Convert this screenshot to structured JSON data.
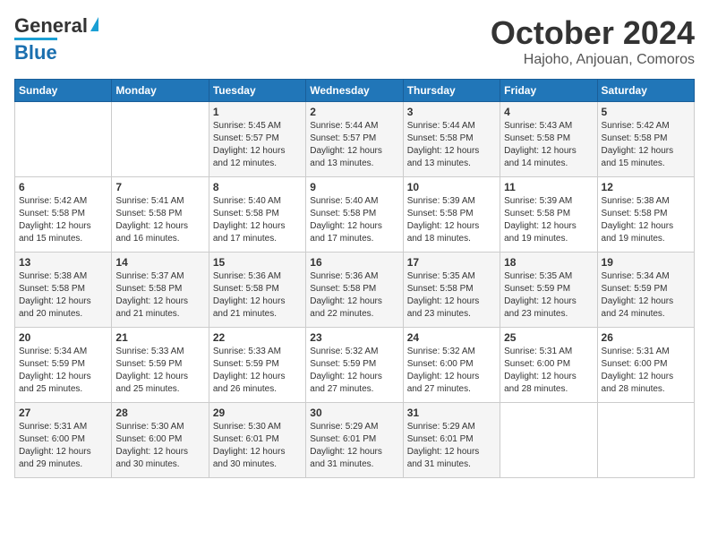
{
  "header": {
    "logo_line1": "General",
    "logo_line2": "Blue",
    "month": "October 2024",
    "location": "Hajoho, Anjouan, Comoros"
  },
  "days_of_week": [
    "Sunday",
    "Monday",
    "Tuesday",
    "Wednesday",
    "Thursday",
    "Friday",
    "Saturday"
  ],
  "weeks": [
    [
      {
        "day": "",
        "details": ""
      },
      {
        "day": "",
        "details": ""
      },
      {
        "day": "1",
        "details": "Sunrise: 5:45 AM\nSunset: 5:57 PM\nDaylight: 12 hours\nand 12 minutes."
      },
      {
        "day": "2",
        "details": "Sunrise: 5:44 AM\nSunset: 5:57 PM\nDaylight: 12 hours\nand 13 minutes."
      },
      {
        "day": "3",
        "details": "Sunrise: 5:44 AM\nSunset: 5:58 PM\nDaylight: 12 hours\nand 13 minutes."
      },
      {
        "day": "4",
        "details": "Sunrise: 5:43 AM\nSunset: 5:58 PM\nDaylight: 12 hours\nand 14 minutes."
      },
      {
        "day": "5",
        "details": "Sunrise: 5:42 AM\nSunset: 5:58 PM\nDaylight: 12 hours\nand 15 minutes."
      }
    ],
    [
      {
        "day": "6",
        "details": "Sunrise: 5:42 AM\nSunset: 5:58 PM\nDaylight: 12 hours\nand 15 minutes."
      },
      {
        "day": "7",
        "details": "Sunrise: 5:41 AM\nSunset: 5:58 PM\nDaylight: 12 hours\nand 16 minutes."
      },
      {
        "day": "8",
        "details": "Sunrise: 5:40 AM\nSunset: 5:58 PM\nDaylight: 12 hours\nand 17 minutes."
      },
      {
        "day": "9",
        "details": "Sunrise: 5:40 AM\nSunset: 5:58 PM\nDaylight: 12 hours\nand 17 minutes."
      },
      {
        "day": "10",
        "details": "Sunrise: 5:39 AM\nSunset: 5:58 PM\nDaylight: 12 hours\nand 18 minutes."
      },
      {
        "day": "11",
        "details": "Sunrise: 5:39 AM\nSunset: 5:58 PM\nDaylight: 12 hours\nand 19 minutes."
      },
      {
        "day": "12",
        "details": "Sunrise: 5:38 AM\nSunset: 5:58 PM\nDaylight: 12 hours\nand 19 minutes."
      }
    ],
    [
      {
        "day": "13",
        "details": "Sunrise: 5:38 AM\nSunset: 5:58 PM\nDaylight: 12 hours\nand 20 minutes."
      },
      {
        "day": "14",
        "details": "Sunrise: 5:37 AM\nSunset: 5:58 PM\nDaylight: 12 hours\nand 21 minutes."
      },
      {
        "day": "15",
        "details": "Sunrise: 5:36 AM\nSunset: 5:58 PM\nDaylight: 12 hours\nand 21 minutes."
      },
      {
        "day": "16",
        "details": "Sunrise: 5:36 AM\nSunset: 5:58 PM\nDaylight: 12 hours\nand 22 minutes."
      },
      {
        "day": "17",
        "details": "Sunrise: 5:35 AM\nSunset: 5:58 PM\nDaylight: 12 hours\nand 23 minutes."
      },
      {
        "day": "18",
        "details": "Sunrise: 5:35 AM\nSunset: 5:59 PM\nDaylight: 12 hours\nand 23 minutes."
      },
      {
        "day": "19",
        "details": "Sunrise: 5:34 AM\nSunset: 5:59 PM\nDaylight: 12 hours\nand 24 minutes."
      }
    ],
    [
      {
        "day": "20",
        "details": "Sunrise: 5:34 AM\nSunset: 5:59 PM\nDaylight: 12 hours\nand 25 minutes."
      },
      {
        "day": "21",
        "details": "Sunrise: 5:33 AM\nSunset: 5:59 PM\nDaylight: 12 hours\nand 25 minutes."
      },
      {
        "day": "22",
        "details": "Sunrise: 5:33 AM\nSunset: 5:59 PM\nDaylight: 12 hours\nand 26 minutes."
      },
      {
        "day": "23",
        "details": "Sunrise: 5:32 AM\nSunset: 5:59 PM\nDaylight: 12 hours\nand 27 minutes."
      },
      {
        "day": "24",
        "details": "Sunrise: 5:32 AM\nSunset: 6:00 PM\nDaylight: 12 hours\nand 27 minutes."
      },
      {
        "day": "25",
        "details": "Sunrise: 5:31 AM\nSunset: 6:00 PM\nDaylight: 12 hours\nand 28 minutes."
      },
      {
        "day": "26",
        "details": "Sunrise: 5:31 AM\nSunset: 6:00 PM\nDaylight: 12 hours\nand 28 minutes."
      }
    ],
    [
      {
        "day": "27",
        "details": "Sunrise: 5:31 AM\nSunset: 6:00 PM\nDaylight: 12 hours\nand 29 minutes."
      },
      {
        "day": "28",
        "details": "Sunrise: 5:30 AM\nSunset: 6:00 PM\nDaylight: 12 hours\nand 30 minutes."
      },
      {
        "day": "29",
        "details": "Sunrise: 5:30 AM\nSunset: 6:01 PM\nDaylight: 12 hours\nand 30 minutes."
      },
      {
        "day": "30",
        "details": "Sunrise: 5:29 AM\nSunset: 6:01 PM\nDaylight: 12 hours\nand 31 minutes."
      },
      {
        "day": "31",
        "details": "Sunrise: 5:29 AM\nSunset: 6:01 PM\nDaylight: 12 hours\nand 31 minutes."
      },
      {
        "day": "",
        "details": ""
      },
      {
        "day": "",
        "details": ""
      }
    ]
  ]
}
